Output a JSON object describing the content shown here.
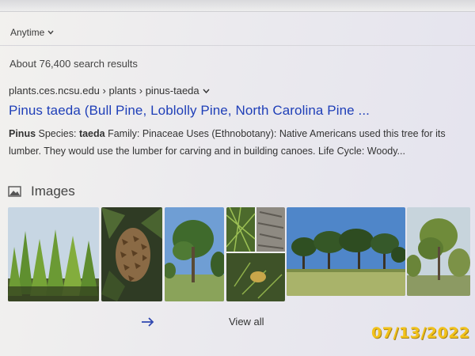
{
  "filters": {
    "time_label": "Anytime"
  },
  "results_count": "About 76,400 search results",
  "result": {
    "breadcrumb": "plants.ces.ncsu.edu › plants › pinus-taeda",
    "title": "Pinus taeda (Bull Pine, Loblolly Pine, North Carolina Pine ...",
    "snippet": {
      "b1": "Pinus",
      "t1": " Species: ",
      "b2": "taeda",
      "t2": " Family: Pinaceae Uses (Ethnobotany): Native Americans used this tree for its lumber. They would use the lumber for carving and in building canoes. Life Cycle: Woody..."
    }
  },
  "images": {
    "heading": "Images",
    "view_all": "View all"
  },
  "watermark_date": "07/13/2022",
  "colors": {
    "link": "#1f3fb8",
    "stamp": "#f2c21a"
  },
  "icons": {
    "filter_chevron": "chevron-down-icon",
    "crumb_chevron": "chevron-down-icon",
    "images": "image-icon",
    "view_all": "arrow-right-icon"
  }
}
